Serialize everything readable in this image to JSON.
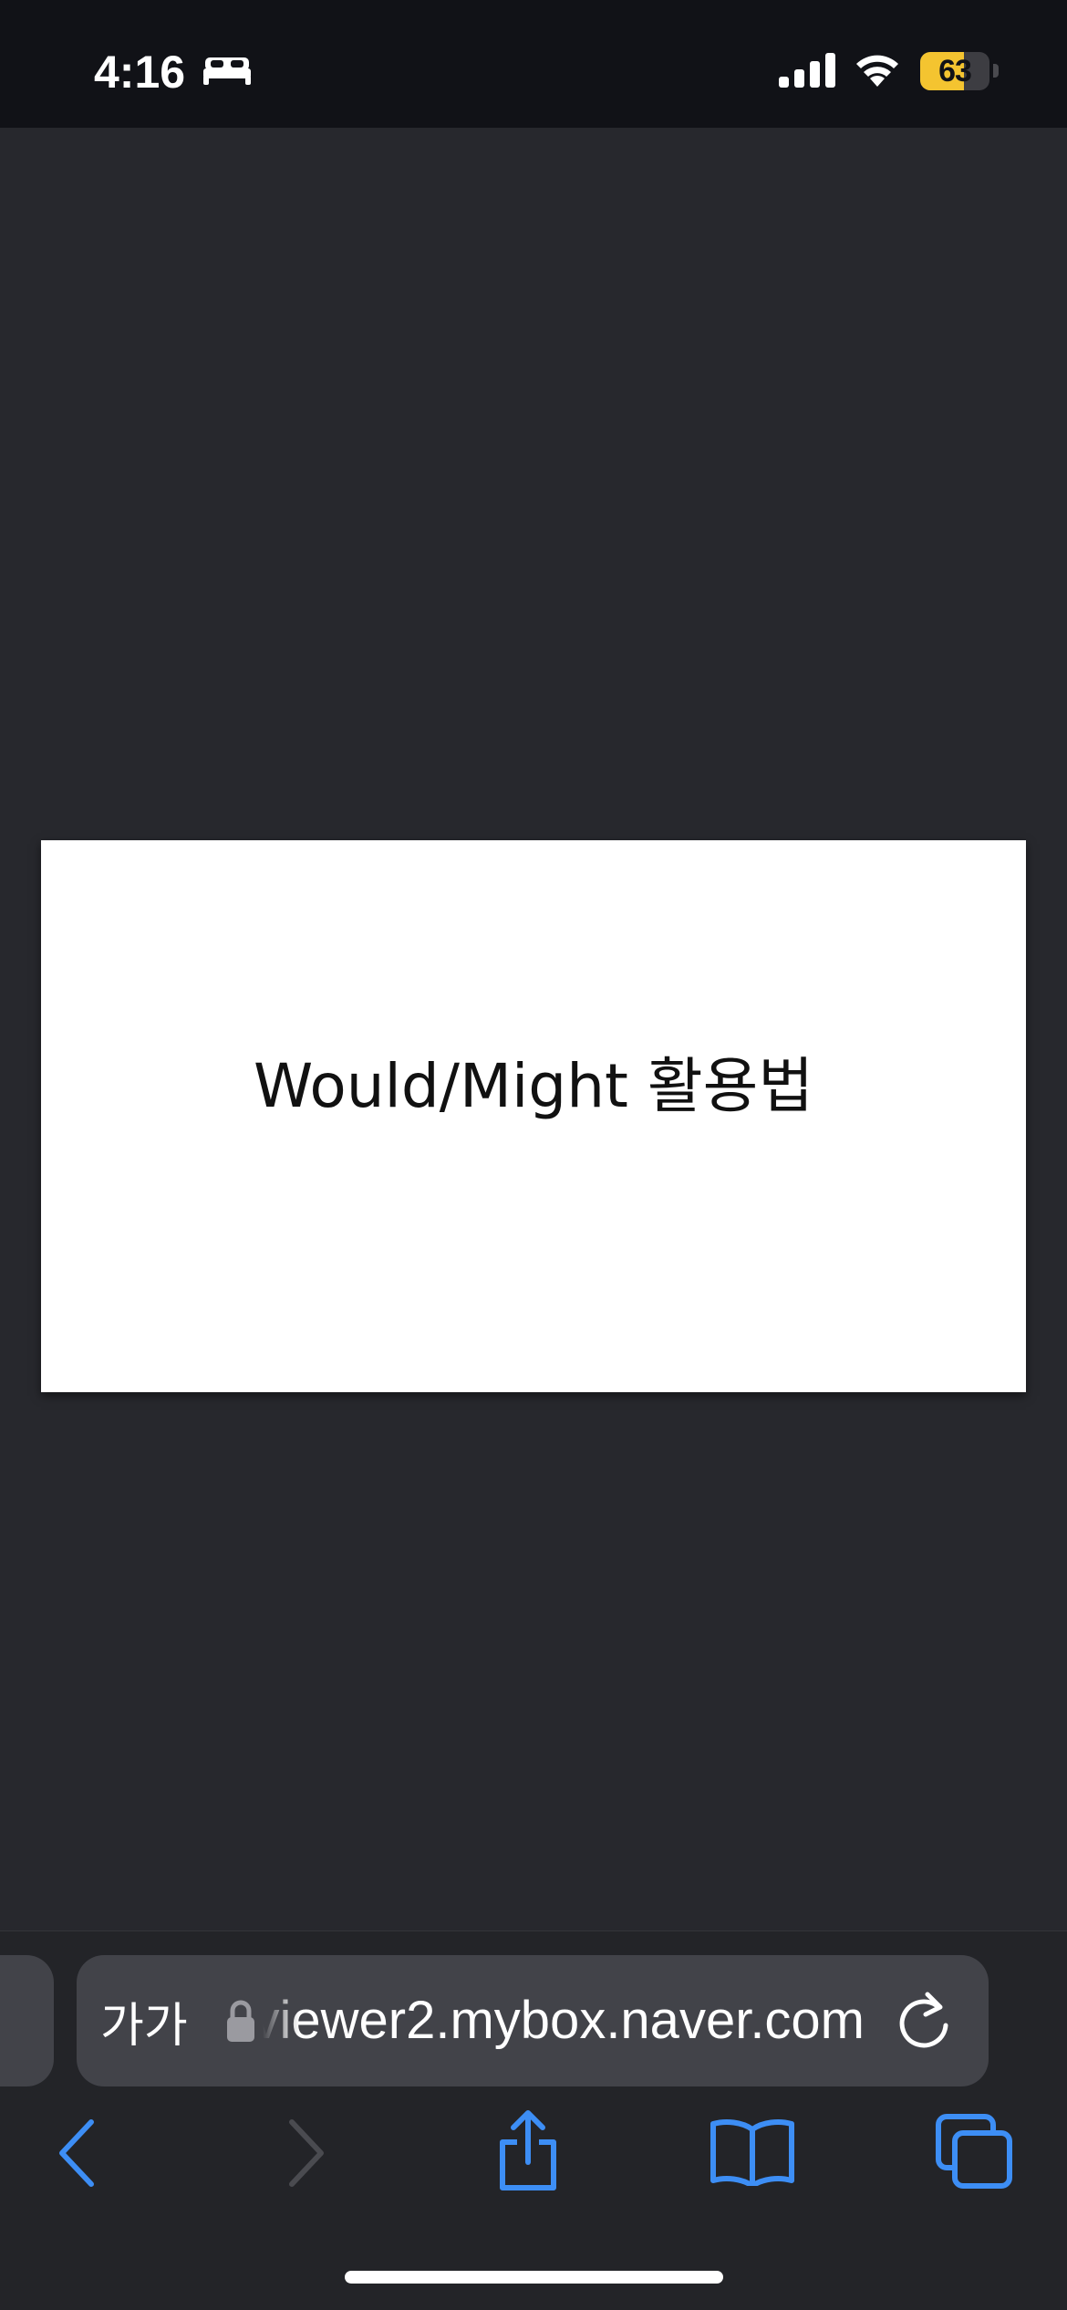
{
  "status_bar": {
    "time": "4:16",
    "sleep_icon": "bed-icon",
    "signal_icon": "cellular-signal-icon",
    "wifi_icon": "wifi-icon",
    "battery_level": "63",
    "battery_fraction": 0.63,
    "battery_color": "#f4c430"
  },
  "slide": {
    "title": "Would/Might 활용법"
  },
  "address_bar": {
    "text_size_button": "가가",
    "lock_icon": "lock-icon",
    "url": "viewer2.mybox.naver.com",
    "reload_icon": "reload-icon"
  },
  "toolbar": {
    "back_icon": "chevron-left-icon",
    "forward_icon": "chevron-right-icon",
    "share_icon": "share-icon",
    "bookmarks_icon": "book-icon",
    "tabs_icon": "tabs-icon",
    "accent_color": "#3d8ef5"
  }
}
